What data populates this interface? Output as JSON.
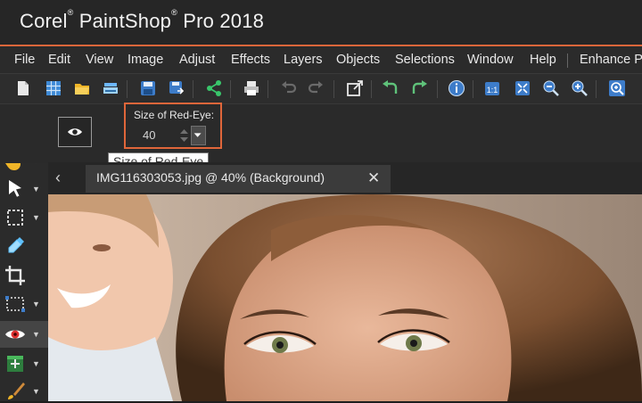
{
  "window": {
    "title_brand": "Corel",
    "title_name": "PaintShop",
    "title_rest": "Pro 2018"
  },
  "menu": {
    "items": [
      {
        "label": "File"
      },
      {
        "label": "Edit"
      },
      {
        "label": "View"
      },
      {
        "label": "Image"
      },
      {
        "label": "Adjust"
      },
      {
        "label": "Effects"
      },
      {
        "label": "Layers"
      },
      {
        "label": "Objects"
      },
      {
        "label": "Selections"
      },
      {
        "label": "Window"
      },
      {
        "label": "Help"
      },
      {
        "label": "Enhance P"
      }
    ]
  },
  "toolbar": {
    "icons": [
      "new-file-icon",
      "browse-grid-icon",
      "open-folder-icon",
      "scan-icon",
      "save-icon",
      "save-as-icon",
      "share-icon",
      "print-icon",
      "undo-icon",
      "redo-icon",
      "crop-resize-icon",
      "rotate-left-icon",
      "rotate-right-icon",
      "info-icon",
      "actual-size-icon",
      "fit-window-icon",
      "zoom-out-icon",
      "zoom-in-icon",
      "zoom-fit-icon"
    ]
  },
  "options": {
    "preset_icon": "eye-icon",
    "size_label": "Size of Red-Eye:",
    "size_value": "40",
    "tooltip": "Size of Red-Eye"
  },
  "document": {
    "tab_label": "IMG116303053.jpg @  40% (Background)",
    "close_symbol": "✕"
  },
  "left_tools": {
    "items": [
      {
        "name": "pan-tool-icon"
      },
      {
        "name": "pick-tool-icon"
      },
      {
        "name": "selection-tool-icon"
      },
      {
        "name": "dropper-tool-icon"
      },
      {
        "name": "crop-tool-icon"
      },
      {
        "name": "straighten-tool-icon"
      },
      {
        "name": "red-eye-tool-icon",
        "active": true
      },
      {
        "name": "makeover-tool-icon"
      },
      {
        "name": "brush-tool-icon"
      }
    ]
  },
  "colors": {
    "accent": "#e0663a"
  }
}
